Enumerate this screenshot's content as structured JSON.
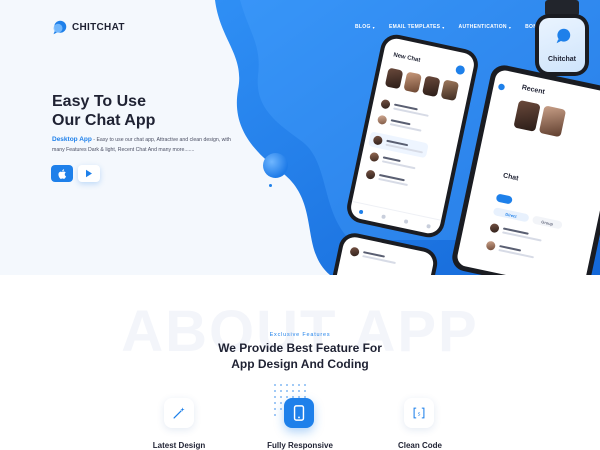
{
  "brand": {
    "name": "CHITCHAT"
  },
  "nav": {
    "items": [
      {
        "label": "BLOG"
      },
      {
        "label": "EMAIL TEMPLATES"
      },
      {
        "label": "AUTHENTICATION"
      },
      {
        "label": "BONUS PAGE"
      }
    ]
  },
  "hero": {
    "title_line1": "Easy To Use",
    "title_line2": "Our Chat App",
    "desc_highlight": "Desktop App",
    "desc_text": " - Easy to use our chat app, Attractive and clean design, with many Features Dark & light, Recent Chat And many more.......",
    "buttons": [
      {
        "icon": "apple-icon"
      },
      {
        "icon": "play-icon"
      }
    ]
  },
  "devices": {
    "phone_title": "New Chat",
    "tablet_title": "Recent",
    "tablet_section": "Chat",
    "tablet_tabs": [
      "Direct",
      "Group"
    ],
    "watch_label": "Chitchat"
  },
  "about": {
    "watermark": "ABOUT APP",
    "eyebrow": "Exclusive Features",
    "title_line1": "We Provide Best Feature For",
    "title_line2": "App Design And Coding",
    "features": [
      {
        "label": "Latest Design",
        "icon": "magic-wand-icon"
      },
      {
        "label": "Fully Responsive",
        "icon": "mobile-icon"
      },
      {
        "label": "Clean Code",
        "icon": "code-brackets-icon"
      }
    ]
  },
  "colors": {
    "accent": "#1e80ea",
    "dark": "#1f2233",
    "hero_bg": "#f4f8fd"
  }
}
